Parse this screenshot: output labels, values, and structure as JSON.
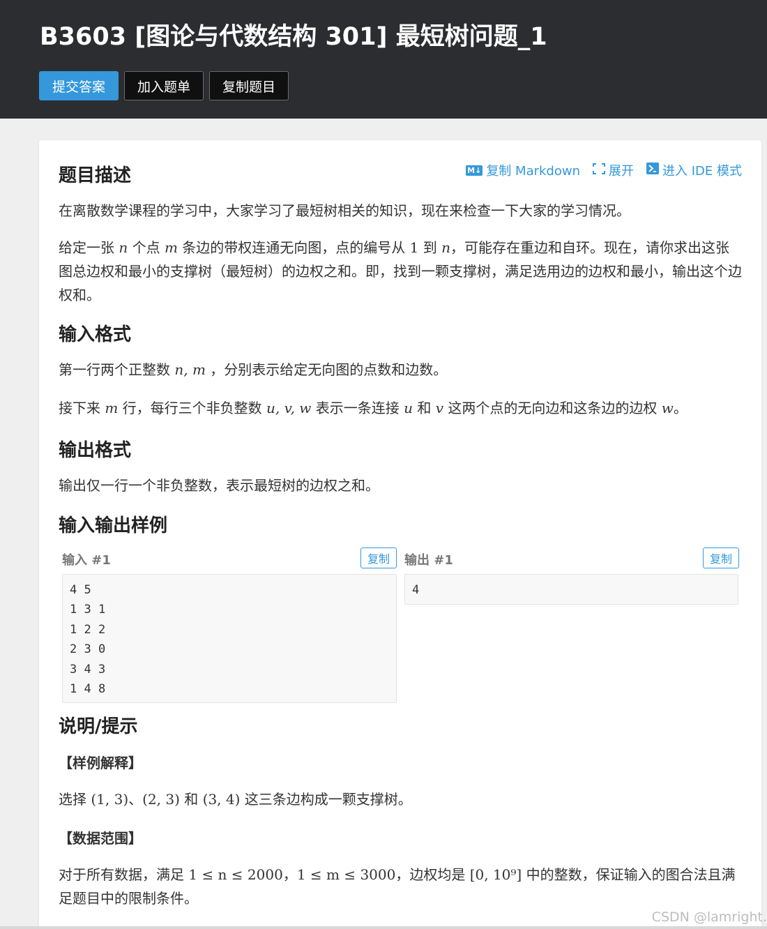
{
  "header": {
    "title": "B3603 [图论与代数结构 301] 最短树问题_1",
    "buttons": {
      "submit": "提交答案",
      "add_to_list": "加入题单",
      "copy_problem": "复制题目"
    }
  },
  "toolbar": {
    "copy_markdown": "复制 Markdown",
    "expand": "展开",
    "ide_mode": "进入 IDE 模式",
    "md_icon_text": "M↓",
    "icons": [
      "markdown-icon",
      "expand-icon",
      "terminal-icon"
    ]
  },
  "description": {
    "heading": "题目描述",
    "p1": "在离散数学课程的学习中，大家学习了最短树相关的知识，现在来检查一下大家的学习情况。",
    "p2": {
      "a": "给定一张 ",
      "n1": "n",
      "b": " 个点 ",
      "m1": "m",
      "c": " 条边的带权连通无向图，点的编号从 ",
      "one": "1",
      "d": " 到 ",
      "n2": "n",
      "e": "，可能存在重边和自环。现在，请你求出这张图总边权和最小的支撑树（最短树）的边权之和。即，找到一颗支撑树，满足选用边的边权和最小，输出这个边权和。"
    }
  },
  "input_format": {
    "heading": "输入格式",
    "p1": {
      "a": "第一行两个正整数 ",
      "vars": "n, m",
      "b": " ，分别表示给定无向图的点数和边数。"
    },
    "p2": {
      "a": "接下来 ",
      "m": "m",
      "b": " 行，每行三个非负整数 ",
      "uvw": "u, v, w",
      "c": " 表示一条连接 ",
      "u": "u",
      "d": " 和 ",
      "v": "v",
      "e": " 这两个点的无向边和这条边的边权 ",
      "w": "w",
      "f": "。"
    }
  },
  "output_format": {
    "heading": "输出格式",
    "p1": "输出仅一行一个非负整数，表示最短树的边权之和。"
  },
  "samples": {
    "heading": "输入输出样例",
    "input_label": "输入 #1",
    "output_label": "输出 #1",
    "copy_label": "复制",
    "input_text": "4 5\n1 3 1\n1 2 2\n2 3 0\n3 4 3\n1 4 8",
    "output_text": "4"
  },
  "hint": {
    "heading": "说明/提示",
    "explain_title": "【样例解释】",
    "explain": {
      "a": "选择 ",
      "e1": "(1, 3)",
      "b": "、",
      "e2": "(2, 3)",
      "c": " 和 ",
      "e3": "(3, 4)",
      "d": " 这三条边构成一颗支撑树。"
    },
    "range_title": "【数据范围】",
    "range": {
      "a": "对于所有数据，满足 ",
      "c1": "1 ≤ n ≤ 2000",
      "b": "，",
      "c2": "1 ≤ m ≤ 3000",
      "c": "，边权均是 ",
      "c3": "[0, 10⁹]",
      "d": " 中的整数，保证输入的图合法且满足题目中的限制条件。"
    }
  },
  "watermark": "CSDN @lamright.",
  "colors": {
    "accent": "#3498db",
    "topbar": "#2c2d30",
    "page_bg": "#efefef"
  }
}
